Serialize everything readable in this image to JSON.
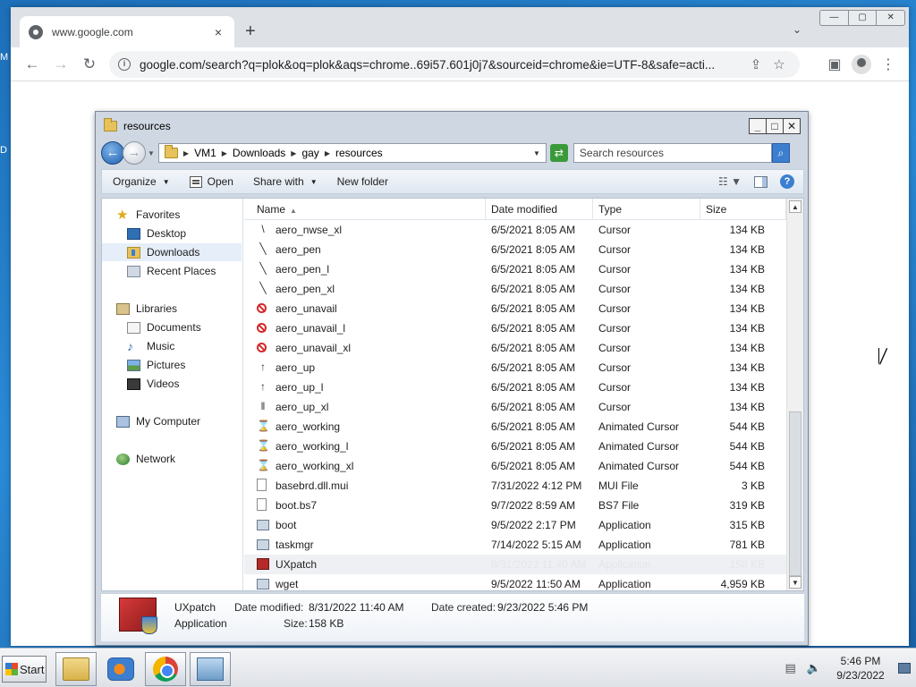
{
  "browser": {
    "tab": {
      "title": "www.google.com",
      "close_icon": "×"
    },
    "new_tab_icon": "+",
    "tab_search_icon": "⌄",
    "window_controls": [
      "—",
      "▢",
      "✕"
    ],
    "nav": {
      "back_icon": "←",
      "forward_icon": "→",
      "reload_icon": "↻"
    },
    "omnibox": {
      "url": "google.com/search?q=plok&oq=plok&aqs=chrome..69i57.601j0j7&sourceid=chrome&ie=UTF-8&safe=acti...",
      "share_icon": "⇪",
      "bookmark_icon": "☆"
    },
    "side_panel_icon": "▣",
    "menu_icon": "⋮"
  },
  "explorer": {
    "title": "resources",
    "window_controls": [
      "_",
      "□",
      "✕"
    ],
    "breadcrumbs": [
      "VM1",
      "Downloads",
      "gay",
      "resources"
    ],
    "search_placeholder": "Search resources",
    "commands": {
      "organize": "Organize",
      "open": "Open",
      "share_with": "Share with",
      "new_folder": "New folder"
    },
    "nav_pane": {
      "favorites": "Favorites",
      "desktop": "Desktop",
      "downloads": "Downloads",
      "recent_places": "Recent Places",
      "libraries": "Libraries",
      "documents": "Documents",
      "music": "Music",
      "pictures": "Pictures",
      "videos": "Videos",
      "my_computer": "My Computer",
      "network": "Network"
    },
    "columns": {
      "name": "Name",
      "date": "Date modified",
      "type": "Type",
      "size": "Size"
    },
    "files": [
      {
        "name": "aero_nwse_xl",
        "date": "6/5/2021 8:05 AM",
        "type": "Cursor",
        "size": "134 KB",
        "icon": "\\"
      },
      {
        "name": "aero_pen",
        "date": "6/5/2021 8:05 AM",
        "type": "Cursor",
        "size": "134 KB",
        "icon": "╲"
      },
      {
        "name": "aero_pen_l",
        "date": "6/5/2021 8:05 AM",
        "type": "Cursor",
        "size": "134 KB",
        "icon": "╲"
      },
      {
        "name": "aero_pen_xl",
        "date": "6/5/2021 8:05 AM",
        "type": "Cursor",
        "size": "134 KB",
        "icon": "╲"
      },
      {
        "name": "aero_unavail",
        "date": "6/5/2021 8:05 AM",
        "type": "Cursor",
        "size": "134 KB",
        "icon": ""
      },
      {
        "name": "aero_unavail_l",
        "date": "6/5/2021 8:05 AM",
        "type": "Cursor",
        "size": "134 KB",
        "icon": ""
      },
      {
        "name": "aero_unavail_xl",
        "date": "6/5/2021 8:05 AM",
        "type": "Cursor",
        "size": "134 KB",
        "icon": ""
      },
      {
        "name": "aero_up",
        "date": "6/5/2021 8:05 AM",
        "type": "Cursor",
        "size": "134 KB",
        "icon": "↑"
      },
      {
        "name": "aero_up_l",
        "date": "6/5/2021 8:05 AM",
        "type": "Cursor",
        "size": "134 KB",
        "icon": "↑"
      },
      {
        "name": "aero_up_xl",
        "date": "6/5/2021 8:05 AM",
        "type": "Cursor",
        "size": "134 KB",
        "icon": "‖"
      },
      {
        "name": "aero_working",
        "date": "6/5/2021 8:05 AM",
        "type": "Animated Cursor",
        "size": "544 KB",
        "icon": "⌛"
      },
      {
        "name": "aero_working_l",
        "date": "6/5/2021 8:05 AM",
        "type": "Animated Cursor",
        "size": "544 KB",
        "icon": "⌛"
      },
      {
        "name": "aero_working_xl",
        "date": "6/5/2021 8:05 AM",
        "type": "Animated Cursor",
        "size": "544 KB",
        "icon": "⌛"
      },
      {
        "name": "basebrd.dll.mui",
        "date": "7/31/2022 4:12 PM",
        "type": "MUI File",
        "size": "3 KB",
        "icon": ""
      },
      {
        "name": "boot.bs7",
        "date": "9/7/2022 8:59 AM",
        "type": "BS7 File",
        "size": "319 KB",
        "icon": ""
      },
      {
        "name": "boot",
        "date": "9/5/2022 2:17 PM",
        "type": "Application",
        "size": "315 KB",
        "icon": ""
      },
      {
        "name": "taskmgr",
        "date": "7/14/2022 5:15 AM",
        "type": "Application",
        "size": "781 KB",
        "icon": ""
      },
      {
        "name": "UXpatch",
        "date": "8/31/2022 11:40 AM",
        "type": "Application",
        "size": "158 KB",
        "icon": ""
      },
      {
        "name": "wget",
        "date": "9/5/2022 11:50 AM",
        "type": "Application",
        "size": "4,959 KB",
        "icon": ""
      }
    ],
    "details": {
      "name": "UXpatch",
      "type": "Application",
      "modified_label": "Date modified:",
      "modified": "8/31/2022 11:40 AM",
      "created_label": "Date created:",
      "created": "9/23/2022 5:46 PM",
      "size_label": "Size:",
      "size": "158 KB"
    }
  },
  "taskbar": {
    "start_label": "Start",
    "clock_time": "5:46 PM",
    "clock_date": "9/23/2022"
  },
  "desktop": {
    "left_peek_1": "M",
    "left_peek_2": "D"
  }
}
